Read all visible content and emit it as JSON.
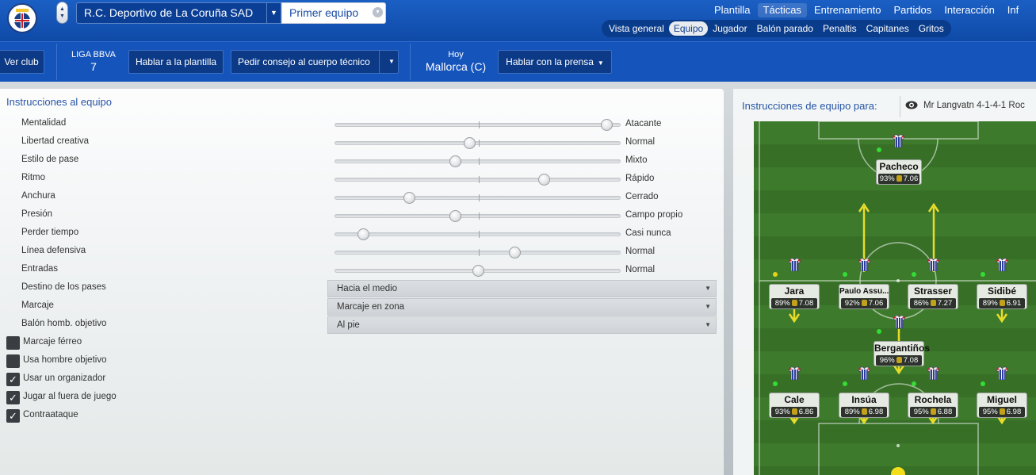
{
  "header": {
    "club_name": "R.C. Deportivo de La Coruña SAD",
    "team_name": "Primer equipo",
    "main_nav": [
      "Plantilla",
      "Tácticas",
      "Entrenamiento",
      "Partidos",
      "Interacción",
      "Inf"
    ],
    "main_nav_active": "Tácticas",
    "sub_nav": [
      "Vista general",
      "Equipo",
      "Jugador",
      "Balón parado",
      "Penaltis",
      "Capitanes",
      "Gritos"
    ],
    "sub_nav_active": "Equipo"
  },
  "toolbar": {
    "view_club": "Ver club",
    "league_label": "LIGA BBVA",
    "league_position": "7",
    "talk_squad": "Hablar a la plantilla",
    "ask_advice": "Pedir consejo al cuerpo técnico",
    "next_match_label": "Hoy",
    "next_match_value": "Mallorca (C)",
    "talk_press": "Hablar con la prensa"
  },
  "instructions": {
    "title": "Instrucciones al equipo",
    "sliders": [
      {
        "label": "Mentalidad",
        "value_text": "Atacante",
        "position": 0.95
      },
      {
        "label": "Libertad creativa",
        "value_text": "Normal",
        "position": 0.47
      },
      {
        "label": "Estilo de pase",
        "value_text": "Mixto",
        "position": 0.42
      },
      {
        "label": "Ritmo",
        "value_text": "Rápido",
        "position": 0.73
      },
      {
        "label": "Anchura",
        "value_text": "Cerrado",
        "position": 0.26
      },
      {
        "label": "Presión",
        "value_text": "Campo propio",
        "position": 0.42
      },
      {
        "label": "Perder tiempo",
        "value_text": "Casi nunca",
        "position": 0.1
      },
      {
        "label": "Línea defensiva",
        "value_text": "Normal",
        "position": 0.63
      },
      {
        "label": "Entradas",
        "value_text": "Normal",
        "position": 0.5
      }
    ],
    "dropdowns": [
      {
        "label": "Destino de los pases",
        "value": "Hacia el medio"
      },
      {
        "label": "Marcaje",
        "value": "Marcaje en zona"
      },
      {
        "label": "Balón homb. objetivo",
        "value": "Al pie"
      }
    ],
    "checkboxes": [
      {
        "label": "Marcaje férreo",
        "checked": false
      },
      {
        "label": "Usa hombre objetivo",
        "checked": false
      },
      {
        "label": "Usar un organizador",
        "checked": true
      },
      {
        "label": "Jugar al fuera de juego",
        "checked": true
      },
      {
        "label": "Contraataque",
        "checked": true
      }
    ]
  },
  "team_view": {
    "title": "Instrucciones de equipo para:",
    "tactic": "Mr Langvatn 4-1-4-1 Roc",
    "players": [
      {
        "name": "Pacheco",
        "pct": "93%",
        "rating": "7.06"
      },
      {
        "name": "Jara",
        "pct": "89%",
        "rating": "7.08"
      },
      {
        "name": "Paulo Assu...",
        "pct": "92%",
        "rating": "7.06"
      },
      {
        "name": "Strasser",
        "pct": "86%",
        "rating": "7.27"
      },
      {
        "name": "Sidibé",
        "pct": "89%",
        "rating": "6.91"
      },
      {
        "name": "Bergantiños",
        "pct": "96%",
        "rating": "7.08"
      },
      {
        "name": "Cale",
        "pct": "93%",
        "rating": "6.86"
      },
      {
        "name": "Insúa",
        "pct": "89%",
        "rating": "6.98"
      },
      {
        "name": "Rochela",
        "pct": "95%",
        "rating": "6.88"
      },
      {
        "name": "Miguel",
        "pct": "95%",
        "rating": "6.98"
      }
    ]
  },
  "colors": {
    "header_blue": "#1b5fc4",
    "title_blue": "#2755a5",
    "pitch_green": "#3d7a2c",
    "arrow_yellow": "#e8dc2a",
    "morale_green": "#33dd33"
  }
}
